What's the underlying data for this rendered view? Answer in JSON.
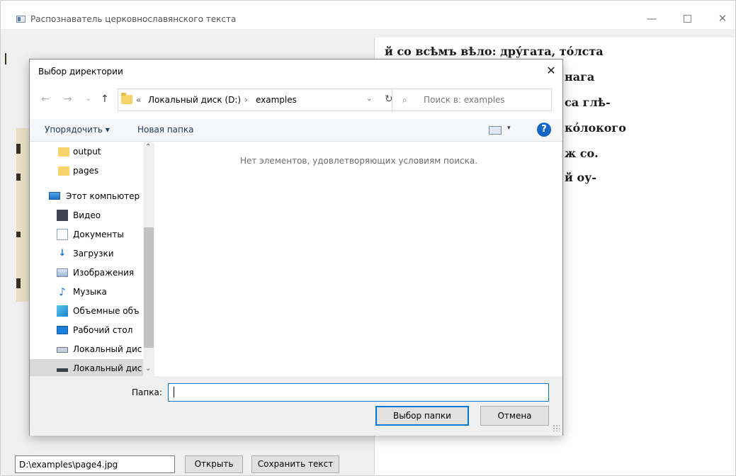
{
  "window": {
    "title": "Распознаватель церковнославянского текста",
    "minimize": "—",
    "close": "✕"
  },
  "main": {
    "path_value": "D:\\examples\\page4.jpg",
    "open_button": "Открыть",
    "save_button": "Сохранить текст",
    "recognized_lines": [
      "й со всѣмъ вѣло: дру́гата, то́лста",
      "нага",
      "са глѣ-",
      "ко́локого",
      "ж со.",
      "й оу-"
    ]
  },
  "dialog": {
    "title": "Выбор директории",
    "close": "✕",
    "nav": {
      "back": "←",
      "forward": "→",
      "recent": "⌄",
      "up": "↑"
    },
    "breadcrumb": {
      "overflow": "«",
      "drive": "Локальный диск (D:)",
      "separator": "›",
      "folder": "examples",
      "dropdown": "⌄",
      "refresh": "↻"
    },
    "search_placeholder": "Поиск в: examples",
    "search_glyph": "⌕",
    "toolbar": {
      "organize": "Упорядочить ▾",
      "new_folder": "Новая папка",
      "view_caret": "▾",
      "help": "?"
    },
    "nav_items": [
      {
        "label": "output",
        "icon": "folder-icon"
      },
      {
        "label": "pages",
        "icon": "folder-icon"
      },
      {
        "label": "Этот компьютер",
        "icon": "computer-icon"
      },
      {
        "label": "Видео",
        "icon": "video-icon"
      },
      {
        "label": "Документы",
        "icon": "documents-icon"
      },
      {
        "label": "Загрузки",
        "icon": "downloads-icon"
      },
      {
        "label": "Изображения",
        "icon": "pictures-icon"
      },
      {
        "label": "Музыка",
        "icon": "music-icon"
      },
      {
        "label": "Объемные объ",
        "icon": "3d-objects-icon"
      },
      {
        "label": "Рабочий стол",
        "icon": "desktop-icon"
      },
      {
        "label": "Локальный дис",
        "icon": "disk-icon"
      },
      {
        "label": "Локальный дис",
        "icon": "disk-icon"
      }
    ],
    "scroll_up": "⌃",
    "scroll_down": "⌄",
    "empty_message": "Нет элементов, удовлетворяющих условиям поиска.",
    "folder_label": "Папка:",
    "folder_value": "",
    "select_button": "Выбор папки",
    "cancel_button": "Отмена"
  }
}
